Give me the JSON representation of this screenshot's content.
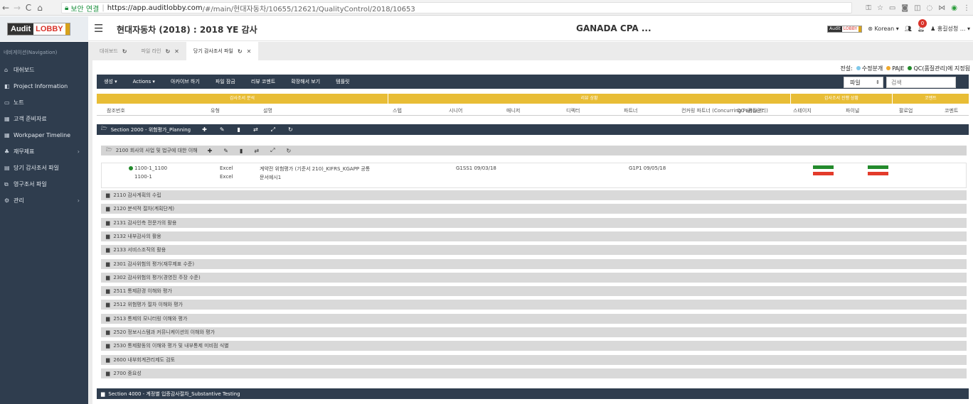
{
  "browser": {
    "secure_label": "보안 연결",
    "url_host": "https://app.auditlobby.com",
    "url_path": "/#/main/현대자동차/10655/12621/QualityControl/2018/10653"
  },
  "app": {
    "logo_part1": "Audit",
    "logo_part2": "LOBBY",
    "engagement_title": "현대자동차 (2018) : 2018 YE 감사",
    "firm_name": "GANADA CPA ...",
    "language": "Korean",
    "notification_count": "0",
    "user": "홍길성청 ..."
  },
  "sidebar": {
    "header": "네비게이션(Navigation)",
    "items": [
      {
        "label": "대쉬보드",
        "icon": "home-icon",
        "chevron": ""
      },
      {
        "label": "Project Information",
        "icon": "info-icon",
        "chevron": ""
      },
      {
        "label": "노트",
        "icon": "note-icon",
        "chevron": ""
      },
      {
        "label": "고객 준비자료",
        "icon": "calendar-icon",
        "chevron": ""
      },
      {
        "label": "Workpaper Timeline",
        "icon": "calendar-icon",
        "chevron": ""
      },
      {
        "label": "재무제표",
        "icon": "hierarchy-icon",
        "chevron": "›"
      },
      {
        "label": "당기 감사조서 파일",
        "icon": "file-icon",
        "chevron": ""
      },
      {
        "label": "영구조서 파일",
        "icon": "copy-icon",
        "chevron": ""
      },
      {
        "label": "관리",
        "icon": "gear-icon",
        "chevron": "›"
      }
    ]
  },
  "tabs": [
    {
      "label": "대쉬보드"
    },
    {
      "label": "파일 라인"
    },
    {
      "label": "당기 감사조서 파일"
    }
  ],
  "legend": {
    "title": "전설:",
    "items": [
      {
        "label": "수정분개",
        "color": "#7fc8ea"
      },
      {
        "label": "PAJE",
        "color": "#f0a92c"
      },
      {
        "label": "QC(품질관리)에 지정됨",
        "color": "#238a2c"
      }
    ]
  },
  "toolbar": {
    "items": [
      "생성 ▾",
      "Actions ▾",
      "아카이브 하기",
      "파일 잠금",
      "리뷰 코멘트",
      "확장해서 보기",
      "템플릿"
    ],
    "file_select": "파일",
    "search_placeholder": "검색"
  },
  "group_headers": [
    "감사조서 분석",
    "리뷰 상황",
    "감사조서 진행 상황",
    "코멘트"
  ],
  "columns": [
    "참조번호",
    "유형",
    "설명",
    "스텝",
    "시니어",
    "매니저",
    "디렉터",
    "파트너",
    "컨커링 파트너 (Concurring Partner)",
    "QC (품질관리)",
    "스테이지",
    "파이널",
    "팔로업",
    "코멘트"
  ],
  "sections": [
    {
      "title": "Section 2000 - 위험평가_Planning"
    },
    {
      "title": "Section 4000 - 계정별 입증감사절차_Substantive Testing"
    }
  ],
  "open_subsection": "2100 회사의 사업 및 법규에 대한 이해",
  "workpaper": {
    "ref1": "1100-1_1100",
    "ref2": "1100-1",
    "type1": "Excel",
    "type2": "Excel",
    "desc1": "계약전 위험평가 (기준서 210)_KIFRS_KGAPP 공통",
    "desc2": "문서예시1",
    "step": "G1SS1 09/03/18",
    "partner": "G1P1 09/05/18"
  },
  "subsections": [
    "2110 감사계획의 수립",
    "2120 분석적 절차(계획단계)",
    "2131 감사인측 전문가의 활용",
    "2132 내부감사의 활용",
    "2133 서비스조직의 활용",
    "2301 감사위험의 평가(재무제표 수준)",
    "2302 감사위험의 평가(경영진 주장 수준)",
    "2511 통제환경 이해와 평가",
    "2512 위험평가 절차 이해와 평가",
    "2513 통제의 모니터링 이해와 평가",
    "2520 정보시스템과 커뮤니케이션의 이해와 평가",
    "2530 통제활동의 이해와 평가 및 내부통제 미비점 식별",
    "2600 내부회계관리제도 검토",
    "2700 중요성"
  ]
}
